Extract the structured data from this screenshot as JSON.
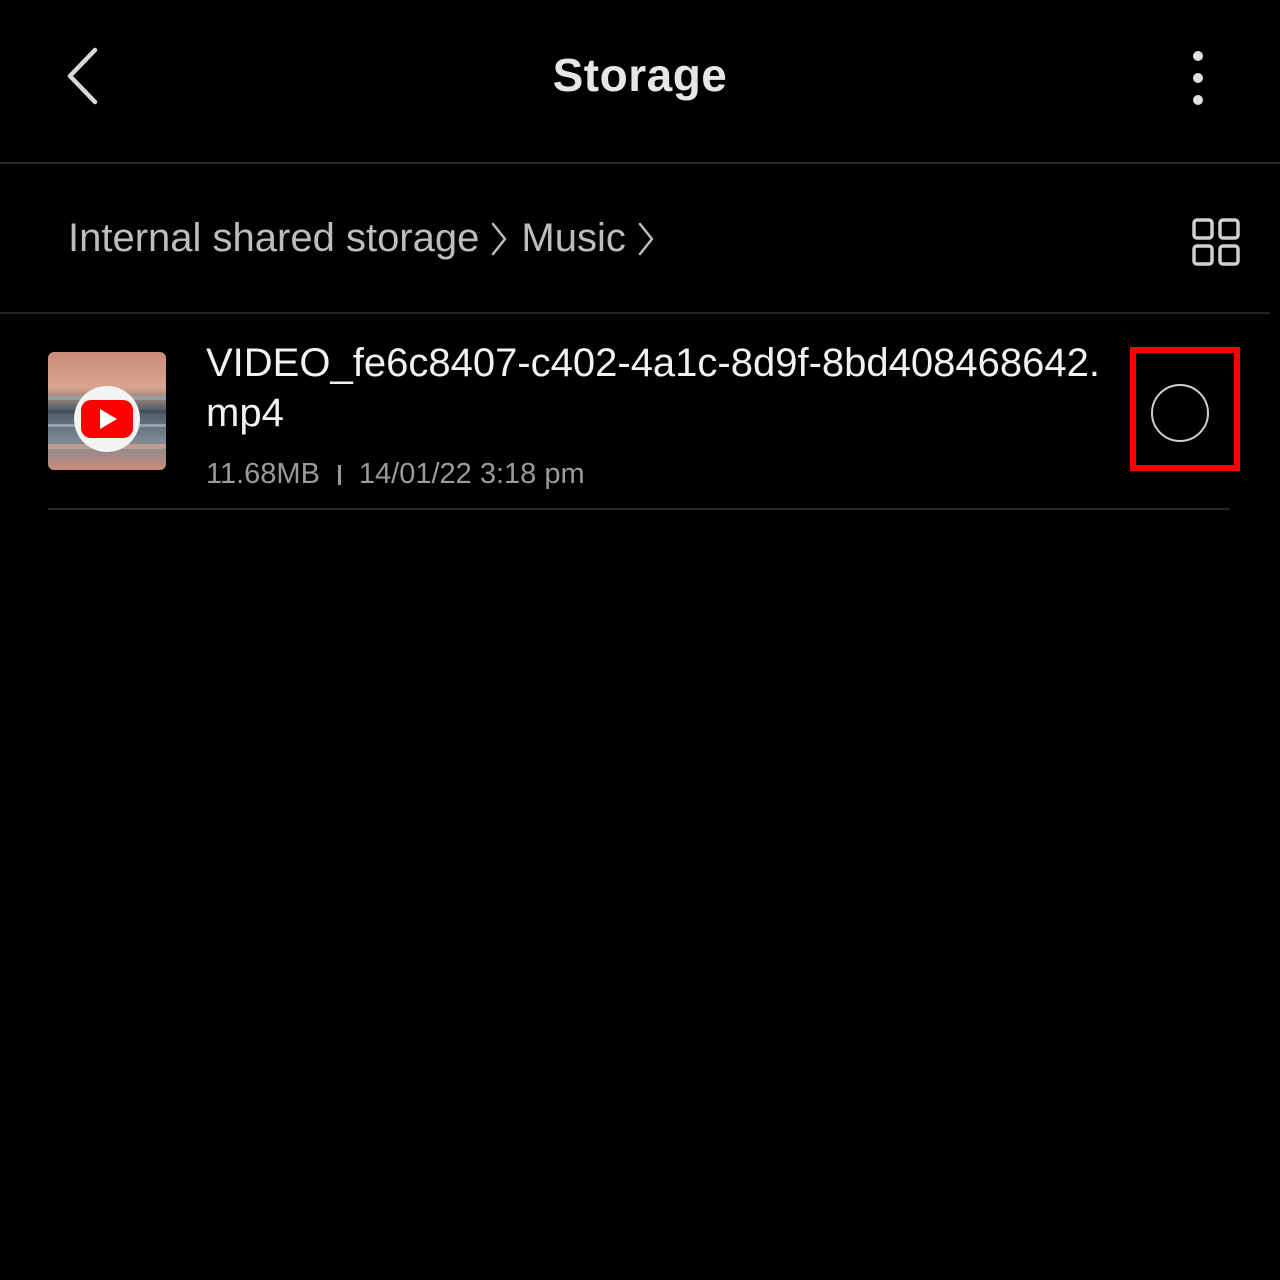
{
  "appbar": {
    "title": "Storage",
    "back_icon": "chevron-left-icon",
    "more_icon": "more-vertical-icon"
  },
  "breadcrumb": {
    "items": [
      "Internal shared storage",
      "Music"
    ],
    "separator_icon": "chevron-right-icon"
  },
  "view_toggle_icon": "grid-view-icon",
  "files": [
    {
      "name": "VIDEO_fe6c8407-c402-4a1c-8d9f-8bd408468642.mp4",
      "size": "11.68MB",
      "date": "14/01/22 3:18 pm",
      "thumbnail_icon": "youtube-icon",
      "selected": false
    }
  ],
  "colors": {
    "background": "#000000",
    "highlight": "#ff0000",
    "youtube_red": "#ff0000"
  }
}
